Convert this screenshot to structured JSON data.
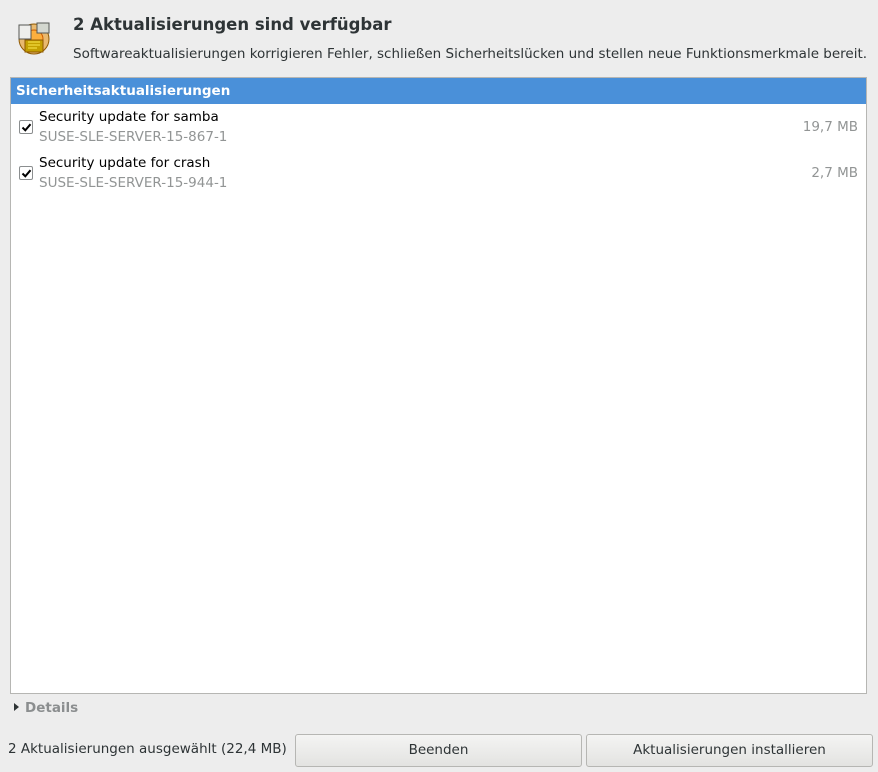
{
  "header": {
    "icon": "software-update-icon",
    "title": "2 Aktualisierungen sind verfügbar",
    "subtitle": "Softwareaktualisierungen korrigieren Fehler, schließen Sicherheitslücken und stellen neue Funktionsmerkmale bereit."
  },
  "list": {
    "section_label": "Sicherheitsaktualisierungen",
    "items": [
      {
        "checked": true,
        "title": "Security update for samba",
        "id": "SUSE-SLE-SERVER-15-867-1",
        "size": "19,7 MB"
      },
      {
        "checked": true,
        "title": "Security update for crash",
        "id": "SUSE-SLE-SERVER-15-944-1",
        "size": "2,7 MB"
      }
    ]
  },
  "details": {
    "label": "Details",
    "icon": "expander-arrow-icon"
  },
  "footer": {
    "status": "2 Aktualisierungen ausgewählt (22,4 MB)",
    "quit_label": "Beenden",
    "install_label": "Aktualisierungen installieren"
  },
  "colors": {
    "selection_blue": "#4a90d9",
    "window_bg": "#ededed",
    "muted_text": "#929595"
  }
}
